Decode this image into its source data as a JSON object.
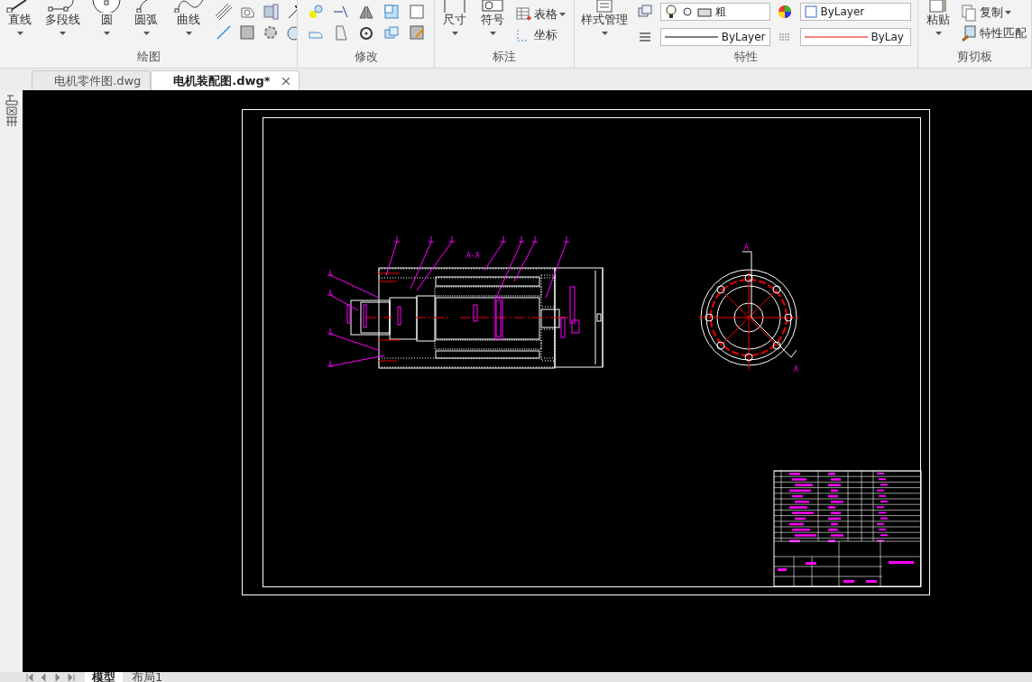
{
  "ribbon": {
    "groups": [
      {
        "label": "绘图",
        "tools": [
          {
            "label": "直线",
            "kind": "large"
          },
          {
            "label": "多段线",
            "kind": "large"
          },
          {
            "label": "圆",
            "kind": "large"
          },
          {
            "label": "圆弧",
            "kind": "large"
          },
          {
            "label": "曲线",
            "kind": "large"
          }
        ]
      },
      {
        "label": "修改"
      },
      {
        "label": "标注",
        "tools": [
          {
            "label": "尺寸",
            "kind": "large"
          },
          {
            "label": "符号",
            "kind": "large"
          },
          {
            "label": "表格",
            "kind": "small"
          },
          {
            "label": "坐标",
            "kind": "small"
          }
        ]
      },
      {
        "label": "特性",
        "tools": [
          {
            "label": "样式管理",
            "kind": "large"
          }
        ],
        "layer_text": "粗",
        "color_text": "ByLayer",
        "linetype": "ByLayer",
        "lineweight": "ByLay"
      },
      {
        "label": "剪切板",
        "tools": [
          {
            "label": "粘贴",
            "kind": "large"
          },
          {
            "label": "复制",
            "kind": "small"
          },
          {
            "label": "特性匹配",
            "kind": "small"
          }
        ]
      }
    ]
  },
  "file_tabs": [
    {
      "label": "电机零件图.dwg",
      "selected": false
    },
    {
      "label": "电机装配图.dwg*",
      "selected": true
    }
  ],
  "drawing": {
    "section_label": "A-A",
    "cut_labels": [
      "A",
      "A"
    ]
  },
  "layout_tabs": [
    {
      "label": "模型",
      "selected": true
    },
    {
      "label": "布局1",
      "selected": false
    }
  ]
}
